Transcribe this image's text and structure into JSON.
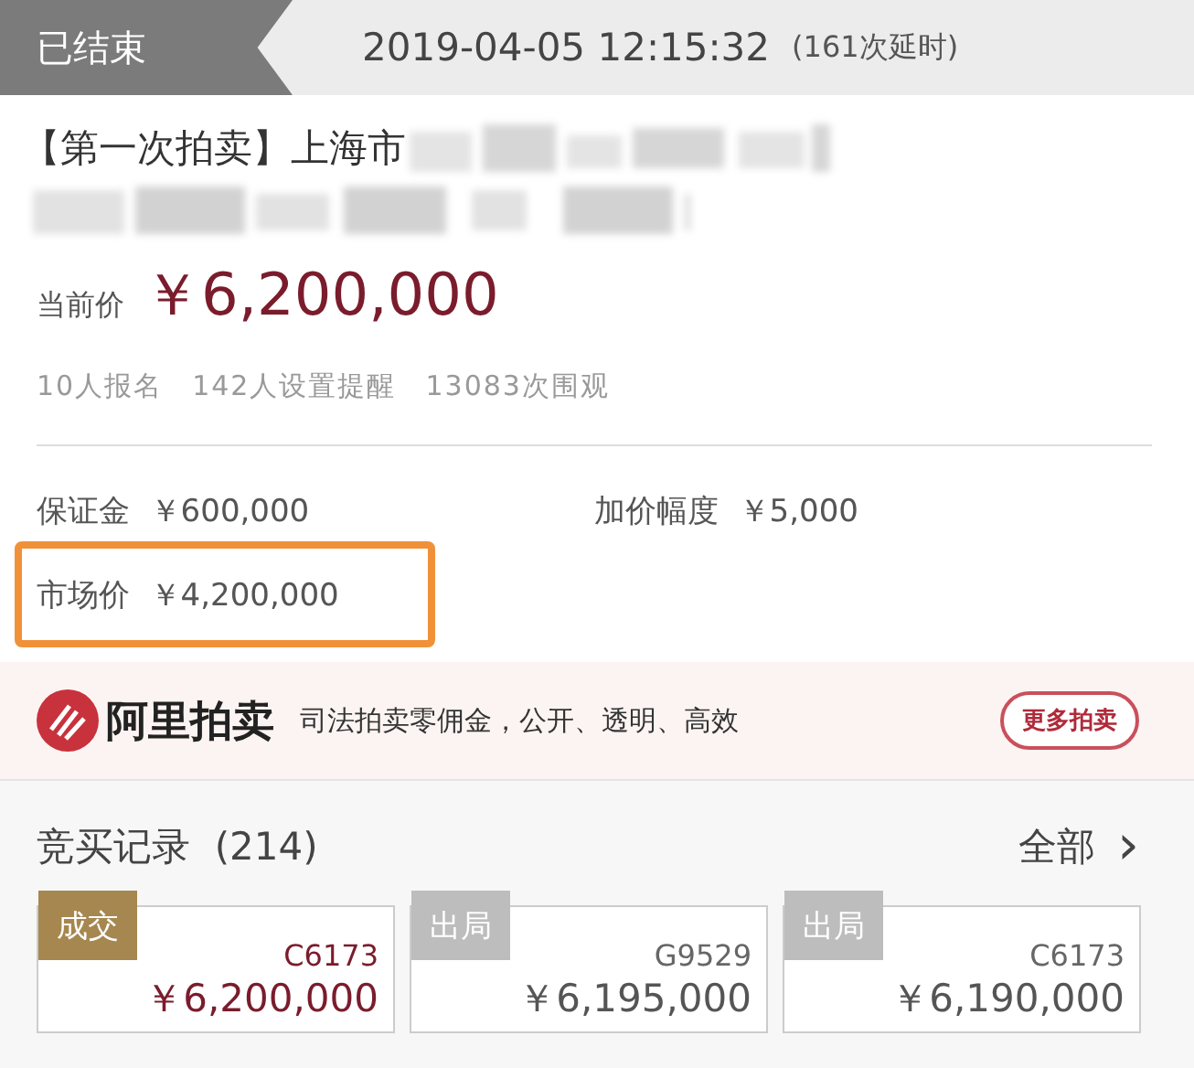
{
  "header": {
    "status": "已结束",
    "end_time": "2019-04-05 12:15:32",
    "extensions": "(161次延时)"
  },
  "title": {
    "prefix": "【第一次拍卖】上海市",
    "redacted": true
  },
  "current_price": {
    "label": "当前价",
    "value": "￥6,200,000"
  },
  "stats": [
    "10人报名",
    "142人设置提醒",
    "13083次围观"
  ],
  "info": [
    {
      "label": "保证金",
      "value": "￥600,000",
      "highlighted": false
    },
    {
      "label": "加价幅度",
      "value": "￥5,000",
      "highlighted": false
    },
    {
      "label": "市场价",
      "value": "￥4,200,000",
      "highlighted": true
    }
  ],
  "banner": {
    "brand": "阿里拍卖",
    "slogan": "司法拍卖零佣金，公开、透明、高效",
    "button": "更多拍卖"
  },
  "records": {
    "title": "竞买记录",
    "count": "(214)",
    "all_link": "全部",
    "arrow": "›",
    "items": [
      {
        "kind": "won",
        "status": "成交",
        "bidder": "C6173",
        "amount": "￥6,200,000"
      },
      {
        "kind": "out",
        "status": "出局",
        "bidder": "G9529",
        "amount": "￥6,195,000"
      },
      {
        "kind": "out",
        "status": "出局",
        "bidder": "C6173",
        "amount": "￥6,190,000"
      }
    ]
  }
}
